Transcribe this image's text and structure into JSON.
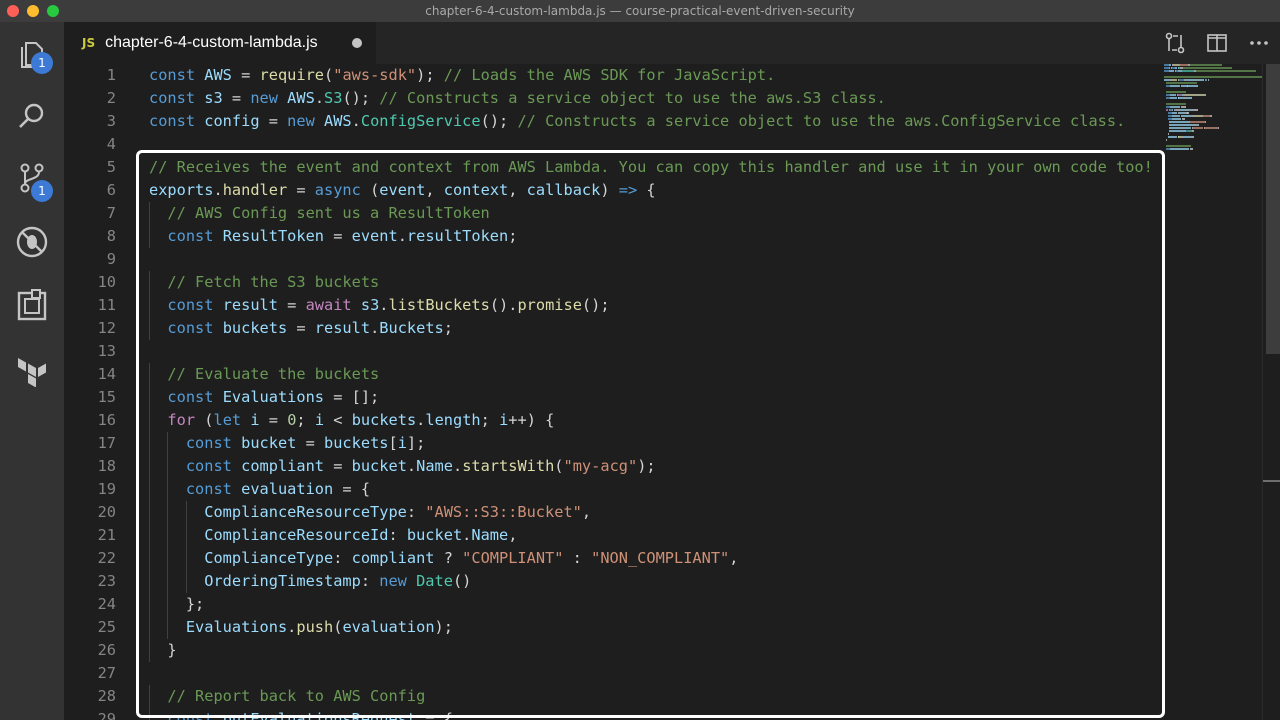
{
  "window": {
    "title": "chapter-6-4-custom-lambda.js — course-practical-event-driven-security"
  },
  "activity_bar": {
    "source_control_badge": "1",
    "extensions_badge": "1"
  },
  "tab": {
    "lang_label": "JS",
    "filename": "chapter-6-4-custom-lambda.js"
  },
  "colors": {
    "keyword": "#569cd6",
    "control": "#c586c0",
    "variable": "#9cdcfe",
    "function": "#dcdcaa",
    "class": "#4ec9b0",
    "string": "#ce9178",
    "comment": "#6a9955",
    "number": "#b5cea8",
    "plain": "#d4d4d4"
  },
  "editor": {
    "lines": [
      {
        "n": "1",
        "tokens": [
          [
            "const ",
            "keyword"
          ],
          [
            "AWS",
            "variable"
          ],
          [
            " = ",
            "plain"
          ],
          [
            "require",
            "function"
          ],
          [
            "(",
            "plain"
          ],
          [
            "\"aws-sdk\"",
            "string"
          ],
          [
            "); ",
            "plain"
          ],
          [
            "// Loads the AWS SDK for JavaScript.",
            "comment"
          ]
        ]
      },
      {
        "n": "2",
        "tokens": [
          [
            "const ",
            "keyword"
          ],
          [
            "s3",
            "variable"
          ],
          [
            " = ",
            "plain"
          ],
          [
            "new ",
            "keyword"
          ],
          [
            "AWS",
            "variable"
          ],
          [
            ".",
            "plain"
          ],
          [
            "S3",
            "class"
          ],
          [
            "(); ",
            "plain"
          ],
          [
            "// Constructs a service object to use the aws.S3 class.",
            "comment"
          ]
        ]
      },
      {
        "n": "3",
        "tokens": [
          [
            "const ",
            "keyword"
          ],
          [
            "config",
            "variable"
          ],
          [
            " = ",
            "plain"
          ],
          [
            "new ",
            "keyword"
          ],
          [
            "AWS",
            "variable"
          ],
          [
            ".",
            "plain"
          ],
          [
            "ConfigService",
            "class"
          ],
          [
            "(); ",
            "plain"
          ],
          [
            "// Constructs a service object to use the aws.ConfigService class.",
            "comment"
          ]
        ]
      },
      {
        "n": "4",
        "tokens": []
      },
      {
        "n": "5",
        "tokens": [
          [
            "// Receives the event and context from AWS Lambda. You can copy this handler and use it in your own code too!",
            "comment"
          ]
        ]
      },
      {
        "n": "6",
        "tokens": [
          [
            "exports",
            "variable"
          ],
          [
            ".",
            "plain"
          ],
          [
            "handler",
            "function"
          ],
          [
            " = ",
            "plain"
          ],
          [
            "async ",
            "keyword"
          ],
          [
            "(",
            "plain"
          ],
          [
            "event",
            "variable"
          ],
          [
            ", ",
            "plain"
          ],
          [
            "context",
            "variable"
          ],
          [
            ", ",
            "plain"
          ],
          [
            "callback",
            "variable"
          ],
          [
            ") ",
            "plain"
          ],
          [
            "=>",
            "keyword"
          ],
          [
            " {",
            "plain"
          ]
        ]
      },
      {
        "n": "7",
        "tokens": [
          [
            "  ",
            "plain"
          ],
          [
            "// AWS Config sent us a ResultToken",
            "comment"
          ]
        ]
      },
      {
        "n": "8",
        "tokens": [
          [
            "  ",
            "plain"
          ],
          [
            "const ",
            "keyword"
          ],
          [
            "ResultToken",
            "variable"
          ],
          [
            " = ",
            "plain"
          ],
          [
            "event",
            "variable"
          ],
          [
            ".",
            "plain"
          ],
          [
            "resultToken",
            "variable"
          ],
          [
            ";",
            "plain"
          ]
        ]
      },
      {
        "n": "9",
        "tokens": []
      },
      {
        "n": "10",
        "tokens": [
          [
            "  ",
            "plain"
          ],
          [
            "// Fetch the S3 buckets",
            "comment"
          ]
        ]
      },
      {
        "n": "11",
        "tokens": [
          [
            "  ",
            "plain"
          ],
          [
            "const ",
            "keyword"
          ],
          [
            "result",
            "variable"
          ],
          [
            " = ",
            "plain"
          ],
          [
            "await ",
            "control"
          ],
          [
            "s3",
            "variable"
          ],
          [
            ".",
            "plain"
          ],
          [
            "listBuckets",
            "function"
          ],
          [
            "().",
            "plain"
          ],
          [
            "promise",
            "function"
          ],
          [
            "();",
            "plain"
          ]
        ]
      },
      {
        "n": "12",
        "tokens": [
          [
            "  ",
            "plain"
          ],
          [
            "const ",
            "keyword"
          ],
          [
            "buckets",
            "variable"
          ],
          [
            " = ",
            "plain"
          ],
          [
            "result",
            "variable"
          ],
          [
            ".",
            "plain"
          ],
          [
            "Buckets",
            "variable"
          ],
          [
            ";",
            "plain"
          ]
        ]
      },
      {
        "n": "13",
        "tokens": []
      },
      {
        "n": "14",
        "tokens": [
          [
            "  ",
            "plain"
          ],
          [
            "// Evaluate the buckets",
            "comment"
          ]
        ]
      },
      {
        "n": "15",
        "tokens": [
          [
            "  ",
            "plain"
          ],
          [
            "const ",
            "keyword"
          ],
          [
            "Evaluations",
            "variable"
          ],
          [
            " = [];",
            "plain"
          ]
        ]
      },
      {
        "n": "16",
        "tokens": [
          [
            "  ",
            "plain"
          ],
          [
            "for ",
            "control"
          ],
          [
            "(",
            "plain"
          ],
          [
            "let ",
            "keyword"
          ],
          [
            "i",
            "variable"
          ],
          [
            " = ",
            "plain"
          ],
          [
            "0",
            "number"
          ],
          [
            "; ",
            "plain"
          ],
          [
            "i",
            "variable"
          ],
          [
            " < ",
            "plain"
          ],
          [
            "buckets",
            "variable"
          ],
          [
            ".",
            "plain"
          ],
          [
            "length",
            "variable"
          ],
          [
            "; ",
            "plain"
          ],
          [
            "i",
            "variable"
          ],
          [
            "++) {",
            "plain"
          ]
        ]
      },
      {
        "n": "17",
        "tokens": [
          [
            "    ",
            "plain"
          ],
          [
            "const ",
            "keyword"
          ],
          [
            "bucket",
            "variable"
          ],
          [
            " = ",
            "plain"
          ],
          [
            "buckets",
            "variable"
          ],
          [
            "[",
            "plain"
          ],
          [
            "i",
            "variable"
          ],
          [
            "];",
            "plain"
          ]
        ]
      },
      {
        "n": "18",
        "tokens": [
          [
            "    ",
            "plain"
          ],
          [
            "const ",
            "keyword"
          ],
          [
            "compliant",
            "variable"
          ],
          [
            " = ",
            "plain"
          ],
          [
            "bucket",
            "variable"
          ],
          [
            ".",
            "plain"
          ],
          [
            "Name",
            "variable"
          ],
          [
            ".",
            "plain"
          ],
          [
            "startsWith",
            "function"
          ],
          [
            "(",
            "plain"
          ],
          [
            "\"my-acg\"",
            "string"
          ],
          [
            ");",
            "plain"
          ]
        ]
      },
      {
        "n": "19",
        "tokens": [
          [
            "    ",
            "plain"
          ],
          [
            "const ",
            "keyword"
          ],
          [
            "evaluation",
            "variable"
          ],
          [
            " = {",
            "plain"
          ]
        ]
      },
      {
        "n": "20",
        "tokens": [
          [
            "      ",
            "plain"
          ],
          [
            "ComplianceResourceType",
            "variable"
          ],
          [
            ": ",
            "plain"
          ],
          [
            "\"AWS::S3::Bucket\"",
            "string"
          ],
          [
            ",",
            "plain"
          ]
        ]
      },
      {
        "n": "21",
        "tokens": [
          [
            "      ",
            "plain"
          ],
          [
            "ComplianceResourceId",
            "variable"
          ],
          [
            ": ",
            "plain"
          ],
          [
            "bucket",
            "variable"
          ],
          [
            ".",
            "plain"
          ],
          [
            "Name",
            "variable"
          ],
          [
            ",",
            "plain"
          ]
        ]
      },
      {
        "n": "22",
        "tokens": [
          [
            "      ",
            "plain"
          ],
          [
            "ComplianceType",
            "variable"
          ],
          [
            ": ",
            "plain"
          ],
          [
            "compliant",
            "variable"
          ],
          [
            " ? ",
            "plain"
          ],
          [
            "\"COMPLIANT\"",
            "string"
          ],
          [
            " : ",
            "plain"
          ],
          [
            "\"NON_COMPLIANT\"",
            "string"
          ],
          [
            ",",
            "plain"
          ]
        ]
      },
      {
        "n": "23",
        "tokens": [
          [
            "      ",
            "plain"
          ],
          [
            "OrderingTimestamp",
            "variable"
          ],
          [
            ": ",
            "plain"
          ],
          [
            "new ",
            "keyword"
          ],
          [
            "Date",
            "class"
          ],
          [
            "()",
            "plain"
          ]
        ]
      },
      {
        "n": "24",
        "tokens": [
          [
            "    ",
            "plain"
          ],
          [
            "};",
            "plain"
          ]
        ]
      },
      {
        "n": "25",
        "tokens": [
          [
            "    ",
            "plain"
          ],
          [
            "Evaluations",
            "variable"
          ],
          [
            ".",
            "plain"
          ],
          [
            "push",
            "function"
          ],
          [
            "(",
            "plain"
          ],
          [
            "evaluation",
            "variable"
          ],
          [
            ");",
            "plain"
          ]
        ]
      },
      {
        "n": "26",
        "tokens": [
          [
            "  ",
            "plain"
          ],
          [
            "}",
            "plain"
          ]
        ]
      },
      {
        "n": "27",
        "tokens": []
      },
      {
        "n": "28",
        "tokens": [
          [
            "  ",
            "plain"
          ],
          [
            "// Report back to AWS Config",
            "comment"
          ]
        ]
      },
      {
        "n": "29",
        "tokens": [
          [
            "  ",
            "plain"
          ],
          [
            "const ",
            "keyword"
          ],
          [
            "putEvaluationsRequest",
            "variable"
          ],
          [
            " = {",
            "plain"
          ]
        ]
      }
    ]
  }
}
